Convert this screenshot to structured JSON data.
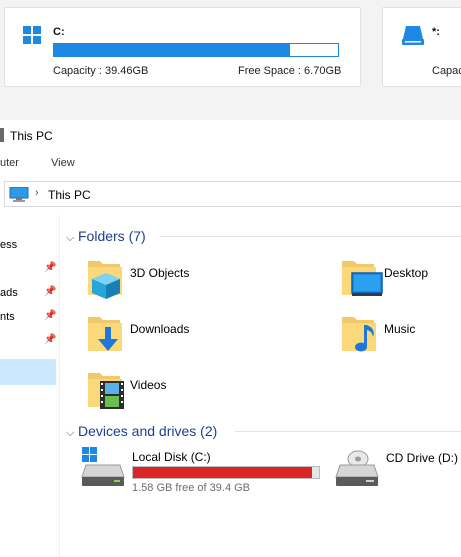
{
  "top_panel": {
    "drives": [
      {
        "letter": "C:",
        "capacity_label": "Capacity : 39.46GB",
        "free_label": "Free Space : 6.70GB",
        "used_fraction": 0.83,
        "bar_color": "#1e88e5"
      },
      {
        "letter": "*:",
        "capacity_label": "Capac"
      }
    ]
  },
  "explorer": {
    "title": "This PC",
    "ribbon_tabs": [
      "uter",
      "View"
    ],
    "address": "This PC",
    "nav": {
      "items": [
        {
          "label": "ess",
          "pinned": false
        },
        {
          "label": "",
          "pinned": true
        },
        {
          "label": "ads",
          "pinned": true
        },
        {
          "label": "nts",
          "pinned": true
        },
        {
          "label": "",
          "pinned": true
        }
      ]
    },
    "folders_header": "Folders (7)",
    "folders": [
      {
        "label": "3D Objects",
        "icon": "3d-objects-icon"
      },
      {
        "label": "Desktop",
        "icon": "desktop-folder-icon"
      },
      {
        "label": "Downloads",
        "icon": "downloads-folder-icon"
      },
      {
        "label": "Music",
        "icon": "music-folder-icon"
      },
      {
        "label": "Videos",
        "icon": "videos-folder-icon"
      }
    ],
    "devices_header": "Devices and drives (2)",
    "drives": [
      {
        "label": "Local Disk (C:)",
        "free_text": "1.58 GB free of 39.4 GB",
        "used_fraction": 0.96,
        "bar_color": "#da2626",
        "icon": "local-disk-icon"
      },
      {
        "label": "CD Drive (D:)",
        "icon": "cd-drive-icon"
      }
    ]
  }
}
